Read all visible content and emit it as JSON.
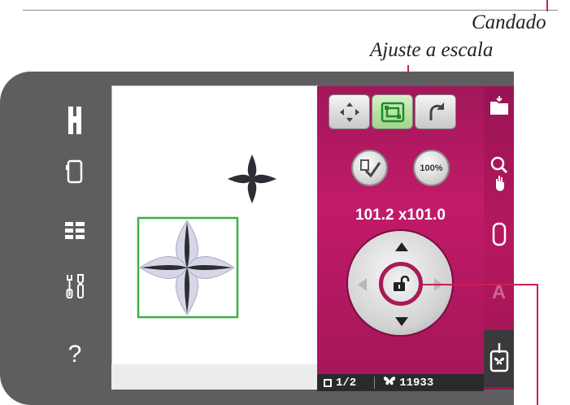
{
  "callouts": {
    "lock": "Candado",
    "scale": "Ajuste a escala"
  },
  "sidebar": {
    "items": [
      {
        "icon": "presser-foot-icon"
      },
      {
        "icon": "hoop-icon"
      },
      {
        "icon": "stitch-list-icon"
      },
      {
        "icon": "tools-icon"
      },
      {
        "icon": "help-icon",
        "label": "?"
      }
    ]
  },
  "panel": {
    "tools": [
      {
        "icon": "move-icon"
      },
      {
        "icon": "scale-icon",
        "selected": true
      },
      {
        "icon": "rotate-icon"
      }
    ],
    "zoom_label": "100%",
    "dimensions": "101.2 x101.0",
    "lock_state": "unlocked"
  },
  "status": {
    "hoop_position": "1/2",
    "stitch_count": "11933"
  },
  "colors": {
    "accent": "#b81a63",
    "panel_dark": "#5e5e60",
    "selection": "#3cb043",
    "leader": "#cc1e54"
  }
}
